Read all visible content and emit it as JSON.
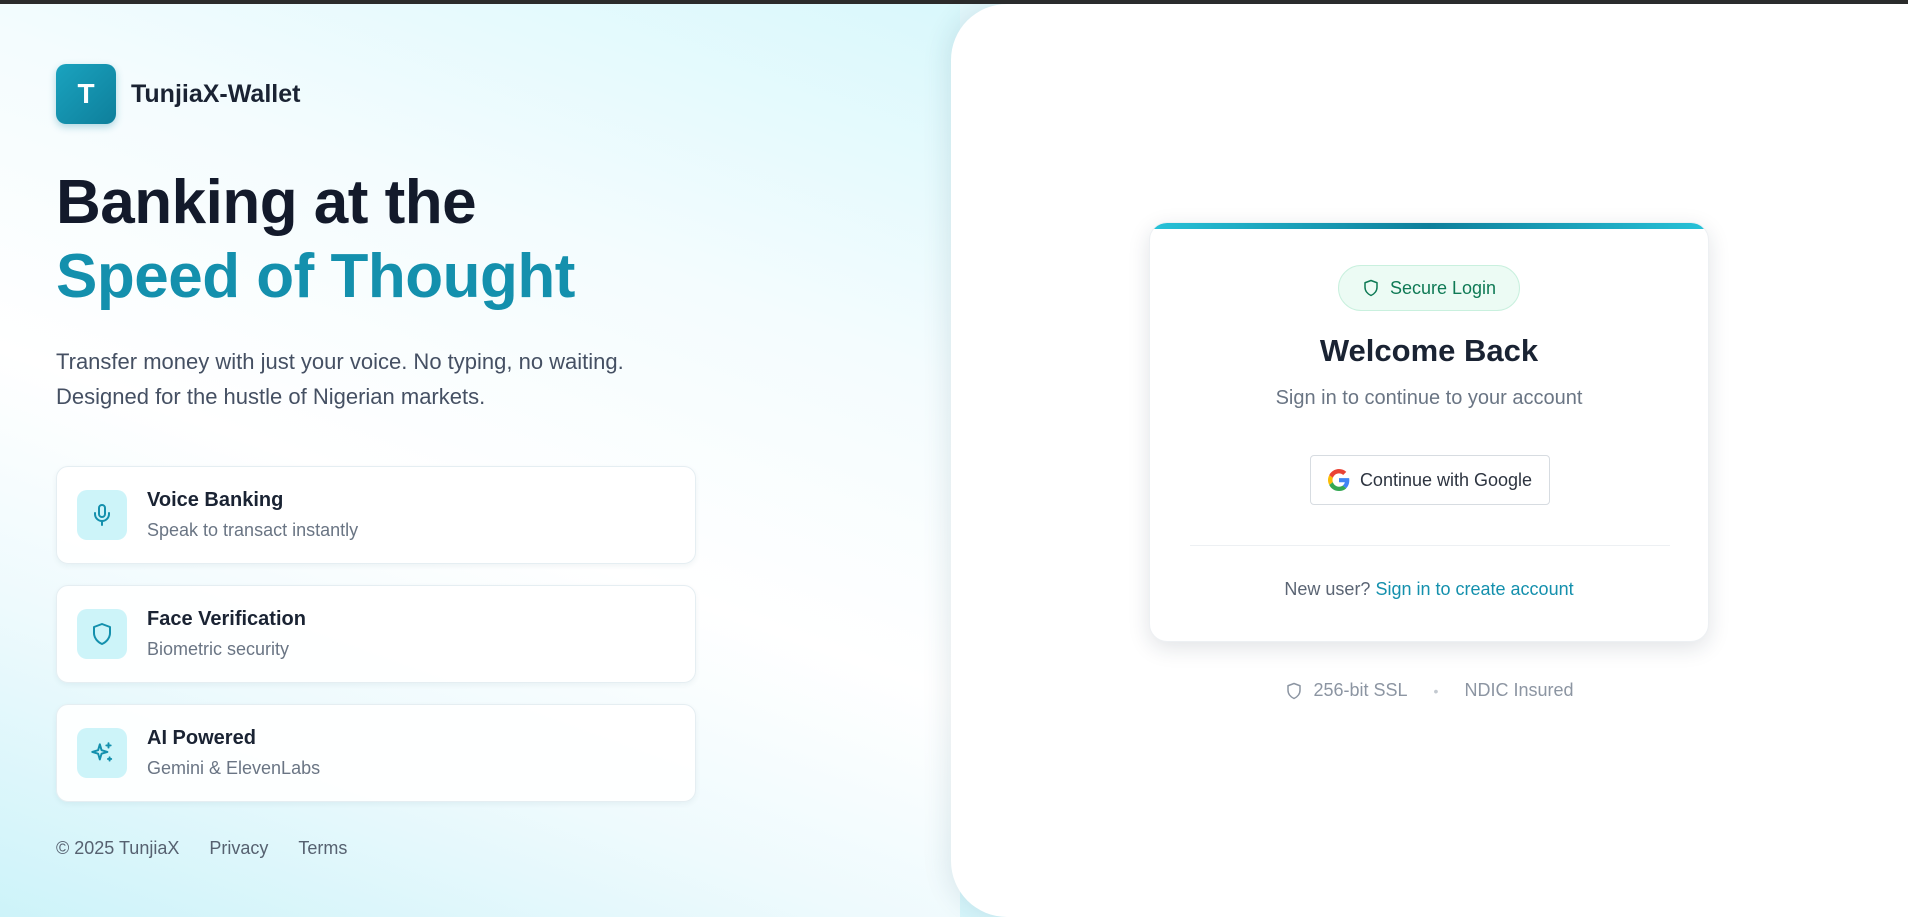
{
  "brand": {
    "logo_letter": "T",
    "name": "TunjiaX-Wallet"
  },
  "hero": {
    "line1": "Banking at the",
    "line2": "Speed of Thought",
    "description": "Transfer money with just your voice. No typing, no waiting. Designed for the hustle of Nigerian markets."
  },
  "features": [
    {
      "title": "Voice Banking",
      "subtitle": "Speak to transact instantly",
      "icon": "microphone-icon"
    },
    {
      "title": "Face Verification",
      "subtitle": "Biometric security",
      "icon": "shield-icon"
    },
    {
      "title": "AI Powered",
      "subtitle": "Gemini & ElevenLabs",
      "icon": "sparkles-icon"
    }
  ],
  "footer": {
    "copyright": "© 2025 TunjiaX",
    "privacy": "Privacy",
    "terms": "Terms"
  },
  "login": {
    "badge": "Secure Login",
    "title": "Welcome Back",
    "subtitle": "Sign in to continue to your account",
    "google_button": "Continue with Google",
    "new_user_prompt": "New user?",
    "create_account_link": "Sign in to create account"
  },
  "trust": {
    "ssl": "256-bit SSL",
    "separator": "•",
    "ndic": "NDIC Insured"
  },
  "colors": {
    "accent": "#1490ad",
    "dark_text": "#131a2b",
    "secure_green": "#0f7a55"
  }
}
